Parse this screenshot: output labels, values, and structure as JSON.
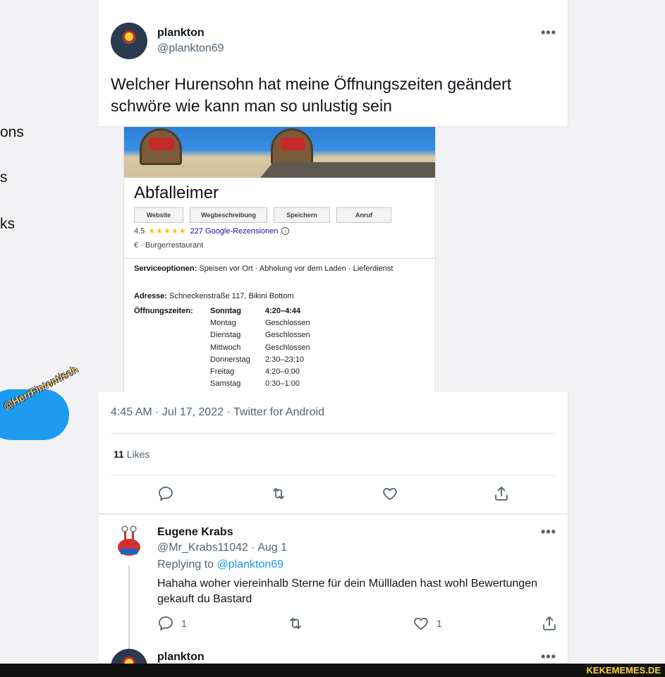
{
  "sidebar_fragments": [
    "ons",
    "s",
    "ks"
  ],
  "watermark": "@HerrFintentisch",
  "top_tweet": {
    "name": "plankton",
    "handle": "@plankton69",
    "text": "Welcher Hurensohn hat meine Öffnungszeiten geändert schwöre wie kann man so unlustig sein",
    "more": "•••"
  },
  "google_card": {
    "title": "Abfalleimer",
    "buttons": [
      "Website",
      "Wegbeschreibung",
      "Speichern",
      "Anruf"
    ],
    "rating": "4,5",
    "stars": "★★★★★",
    "reviews": "227 Google-Rezensionen",
    "info_icon": "ⓘ",
    "category": "€ · Burgerrestaurant",
    "service_label": "Serviceoptionen:",
    "service_value": "Speisen vor Ort · Abholung vor dem Laden · Lieferdienst",
    "address_label": "Adresse:",
    "address_value": "Schneckenstraße 117, Bikini Bottom",
    "hours_label": "Öffnungszeiten:",
    "hours": [
      {
        "day": "Sonntag",
        "time": "4:20–4:44"
      },
      {
        "day": "Montag",
        "time": "Geschlossen"
      },
      {
        "day": "Dienstag",
        "time": "Geschlossen"
      },
      {
        "day": "Mittwoch",
        "time": "Geschlossen"
      },
      {
        "day": "Donnerstag",
        "time": "2:30–23:10"
      },
      {
        "day": "Freitag",
        "time": "4:20–0:00"
      },
      {
        "day": "Samstag",
        "time": "0:30–1:00"
      }
    ]
  },
  "main_tweet_meta": {
    "timestamp": "4:45 AM · Jul 17, 2022 · Twitter for Android",
    "likes_count": "11",
    "likes_label": "Likes"
  },
  "reply": {
    "name": "Eugene Krabs",
    "handle_date": "@Mr_Krabs11042 · Aug 1",
    "replying_prefix": "Replying to",
    "replying_handle": "@plankton69",
    "text": "Hahaha woher viereinhalb Sterne für dein Müllladen hast wohl Bewertungen gekauft du Bastard",
    "reply_count": "1",
    "like_count": "1",
    "more": "•••"
  },
  "next_tweet": {
    "name": "plankton",
    "more": "•••"
  },
  "site_watermark": "KEKEMEMES.DE"
}
